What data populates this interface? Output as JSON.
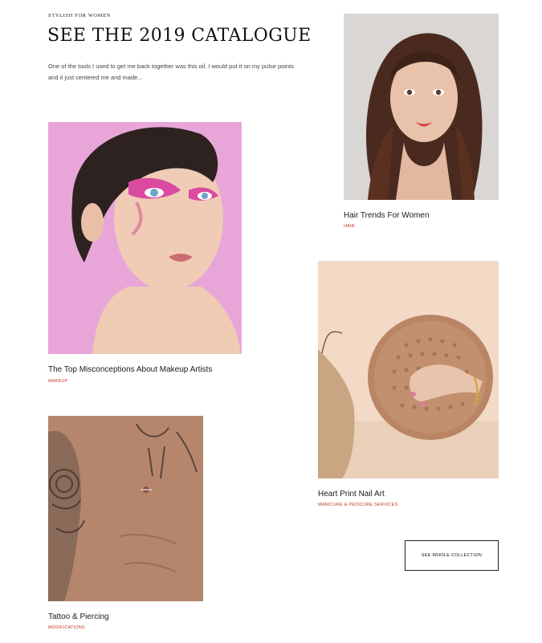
{
  "header": {
    "eyebrow": "STYLISH FOR WOMEN",
    "title": "SEE THE 2019 CATALOGUE",
    "intro": "One of the tools I used to get me back together was this oil. I would put it on my pulse points and it just centered me and made..."
  },
  "cards": [
    {
      "title": "Hair Trends For Women",
      "tag": "HAIR"
    },
    {
      "title": "The Top Misconceptions About Makeup Artists",
      "tag": "MAKEUP"
    },
    {
      "title": "Heart Print Nail Art",
      "tag": "MANICURE & PEDICURE SERVICES"
    },
    {
      "title": "Tattoo & Piercing",
      "tag": "MODIFICATIONS"
    }
  ],
  "cta": {
    "label": "SEE WHOLE COLLECTION"
  },
  "colors": {
    "accent": "#c0392b",
    "text": "#1a1a1a"
  }
}
